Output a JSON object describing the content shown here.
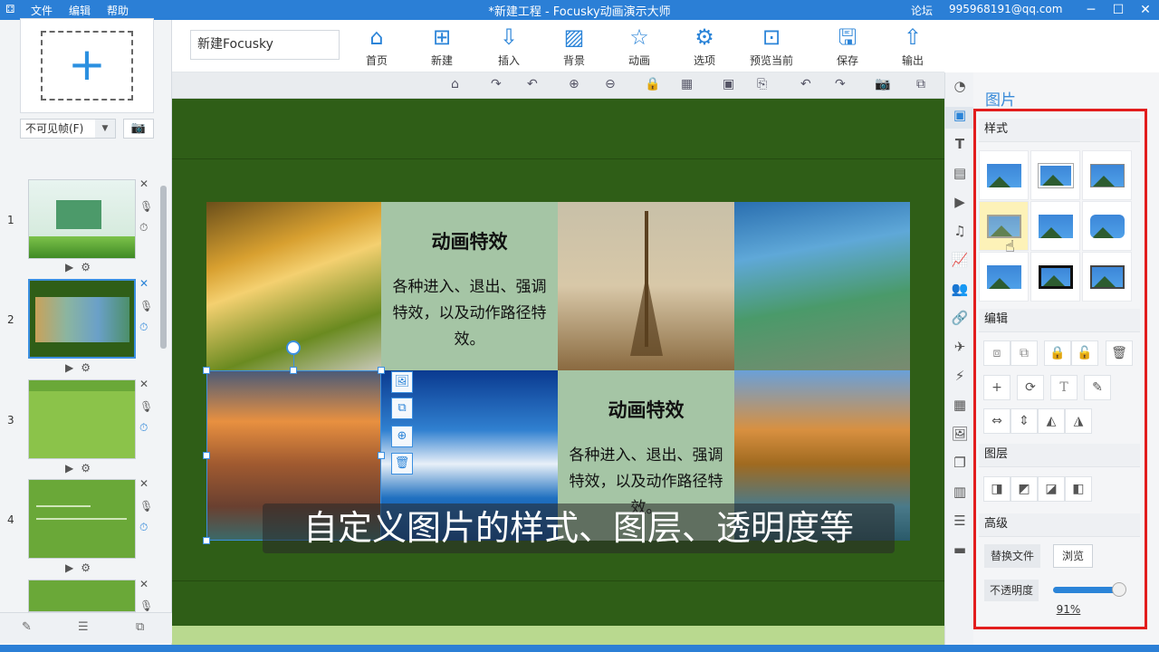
{
  "app": {
    "title": "*新建工程 - Focusky动画演示大师",
    "menu": [
      "文件",
      "编辑",
      "帮助"
    ],
    "forum": "论坛",
    "account": "995968191@qq.com"
  },
  "left": {
    "frame_visibility": "不可见帧(F)",
    "slides": [
      {
        "num": "1"
      },
      {
        "num": "2"
      },
      {
        "num": "3"
      },
      {
        "num": "4"
      }
    ]
  },
  "toolbar": {
    "project_name": "新建Focusky",
    "buttons": [
      {
        "label": "首页",
        "icon": "home-icon"
      },
      {
        "label": "新建",
        "icon": "new-icon"
      },
      {
        "label": "插入",
        "icon": "insert-icon"
      },
      {
        "label": "背景",
        "icon": "background-icon"
      },
      {
        "label": "动画",
        "icon": "animation-icon"
      },
      {
        "label": "选项",
        "icon": "gear-icon"
      },
      {
        "label": "预览当前",
        "icon": "preview-icon"
      },
      {
        "label": "保存",
        "icon": "save-icon"
      },
      {
        "label": "输出",
        "icon": "export-icon"
      }
    ]
  },
  "canvas": {
    "tile_heading": "动画特效",
    "tile_text": "各种进入、退出、强调特效，以及动作路径特效。",
    "subtitle": "自定义图片的样式、图层、透明度等"
  },
  "panel": {
    "title": "图片",
    "sections": {
      "style": "样式",
      "edit": "编辑",
      "layer": "图层",
      "advanced": "高级"
    },
    "replace_file": "替换文件",
    "browse": "浏览",
    "opacity_label": "不透明度",
    "opacity_value": "91%",
    "opacity": 0.91
  },
  "colors": {
    "accent": "#2b84d8",
    "canvas_bg": "#2f5e17",
    "highlight": "#e21d1d"
  }
}
